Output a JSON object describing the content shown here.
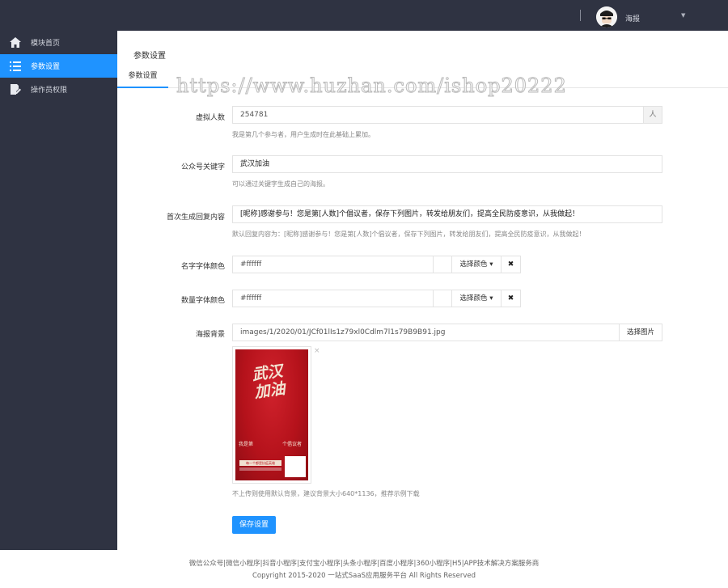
{
  "header": {
    "username": "海报"
  },
  "sidebar": {
    "items": [
      {
        "label": "模块首页"
      },
      {
        "label": "参数设置"
      },
      {
        "label": "操作员权限"
      }
    ]
  },
  "main": {
    "title": "参数设置",
    "tab": "参数设置"
  },
  "watermark": "https://www.huzhan.com/ishop20222",
  "form": {
    "virtual_count": {
      "label": "虚拟人数",
      "value": "254781",
      "unit": "人",
      "help": "我是第几个参与者，用户生成时在此基础上累加。"
    },
    "keyword": {
      "label": "公众号关键字",
      "value": "武汉加油",
      "help": "可以通过关键字生成自己的海报。"
    },
    "reply": {
      "label": "首次生成回复内容",
      "value": "[昵称]感谢参与！您是第[人数]个倡议者，保存下列图片，转发给朋友们，提高全民防疫意识，从我做起！",
      "help": "默认回复内容为：[昵称]感谢参与！您是第[人数]个倡议者，保存下列图片，转发给朋友们，提高全民防疫意识，从我做起！"
    },
    "name_color": {
      "label": "名字字体颜色",
      "value": "#ffffff",
      "pick_label": "选择颜色 ▾",
      "clear_label": "✖"
    },
    "num_color": {
      "label": "数量字体颜色",
      "value": "#ffffff",
      "pick_label": "选择颜色 ▾",
      "clear_label": "✖"
    },
    "bg": {
      "label": "海报背景",
      "value": "images/1/2020/01/JCf01lIs1z79xl0Cdlm7l1s79B9B91.jpg",
      "pick_label": "选择图片",
      "close": "×",
      "help": "不上传则使用默认背景，建议背景大小640*1136，推荐示例下载"
    },
    "poster_text": {
      "calligraphy": "武汉加油",
      "left": "我是第",
      "right": "个倡议者",
      "banner": "每一个都是抗疫英雄"
    },
    "save_label": "保存设置"
  },
  "footer": {
    "links": "微信公众号|微信小程序|抖音小程序|支付宝小程序|头条小程序|百度小程序|360小程序|H5|APP技术解决方案服务商",
    "copyright": "Copyright 2015-2020 一站式SaaS应用服务平台 All Rights Reserved"
  },
  "colors": {
    "sidebar_bg": "#2f3342",
    "accent": "#1f93ff",
    "poster_red": "#b5121b"
  },
  "icons": [
    "home-icon",
    "list-icon",
    "edit-user-icon",
    "avatar",
    "chevron-down-icon",
    "close-icon"
  ]
}
